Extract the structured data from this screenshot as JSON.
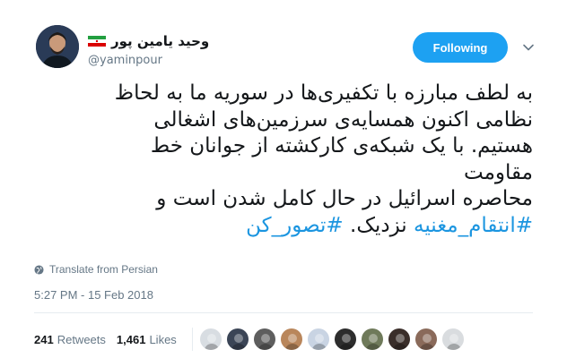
{
  "author": {
    "display_name": "وحید یامین پور",
    "handle": "@yaminpour",
    "flag_icon": "iran-flag-icon"
  },
  "follow_button": {
    "label": "Following",
    "color": "#1da1f2"
  },
  "tweet": {
    "lines": [
      "به لطف مبارزه با تکفیری‌ها در سوریه ما به لحاظ",
      "نظامی اکنون همسایه‌ی سرزمین‌های اشغالی",
      "هستیم. با یک شبکه‌ی کارکشته از جوانان خط",
      "مقاومت",
      "محاصره اسرائیل در حال کامل شدن است و"
    ],
    "last_line_hashtag_1": "#انتقام_مغنیه",
    "last_line_text": " نزدیک. ",
    "last_line_hashtag_2": "#تصور_کن",
    "hashtag_color": "#1b95e0"
  },
  "translate_label": "Translate from Persian",
  "timestamp": "5:27 PM - 15 Feb 2018",
  "stats": {
    "retweets_count": "241",
    "retweets_label": "Retweets",
    "likes_count": "1,461",
    "likes_label": "Likes"
  },
  "liker_avatars": [
    {
      "name": "liker-avatar-1",
      "color": "#d8dde2"
    },
    {
      "name": "liker-avatar-2",
      "color": "#3b4556"
    },
    {
      "name": "liker-avatar-3",
      "color": "#5e5e5e"
    },
    {
      "name": "liker-avatar-4",
      "color": "#b9865b"
    },
    {
      "name": "liker-avatar-5",
      "color": "#c9d4e3"
    },
    {
      "name": "liker-avatar-6",
      "color": "#2d2d2d"
    },
    {
      "name": "liker-avatar-7",
      "color": "#6f7a5a"
    },
    {
      "name": "liker-avatar-8",
      "color": "#3a2e2a"
    },
    {
      "name": "liker-avatar-9",
      "color": "#8a6a5a"
    },
    {
      "name": "liker-avatar-10",
      "color": "#d9dcdf"
    }
  ]
}
